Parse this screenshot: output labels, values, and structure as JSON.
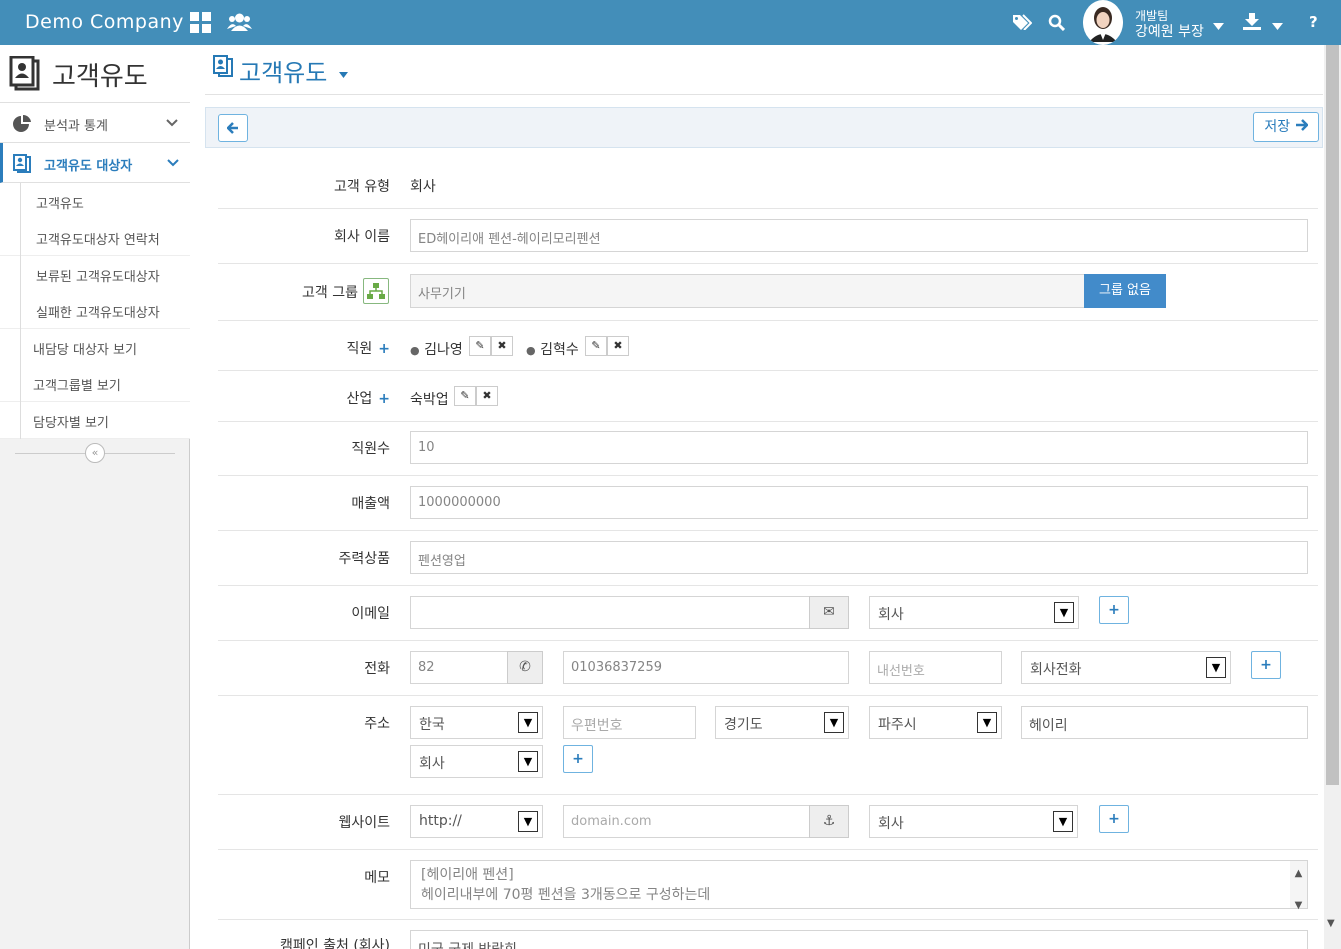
{
  "topbar": {
    "brand": "Demo Company",
    "user_team": "개발팀",
    "user_name": "강예원 부장"
  },
  "sidebar": {
    "title": "고객유도",
    "items": [
      {
        "label": "분석과 통계"
      },
      {
        "label": "고객유도 대상자"
      }
    ],
    "subitems": [
      {
        "label": "고객유도"
      },
      {
        "label": "고객유도대상자 연락처"
      },
      {
        "label": "보류된 고객유도대상자"
      },
      {
        "label": "실패한 고객유도대상자"
      },
      {
        "label": "내담당 대상자 보기"
      },
      {
        "label": "고객그룹별 보기"
      },
      {
        "label": "담당자별 보기"
      }
    ]
  },
  "page": {
    "title": "고객유도",
    "save_label": "저장"
  },
  "form": {
    "customer_type": {
      "label": "고객 유형",
      "value": "회사"
    },
    "company_name": {
      "label": "회사 이름",
      "value": "ED헤이리애 펜션-헤이리모리펜션"
    },
    "customer_group": {
      "label": "고객 그룹",
      "value": "사무기기",
      "button": "그룹 없음"
    },
    "staff": {
      "label": "직원",
      "members": [
        "김나영",
        "김혁수"
      ]
    },
    "industry": {
      "label": "산업",
      "value": "숙박업"
    },
    "employees": {
      "label": "직원수",
      "value": "10"
    },
    "revenue": {
      "label": "매출액",
      "value": "1000000000"
    },
    "main_product": {
      "label": "주력상품",
      "value": "펜션영업"
    },
    "email": {
      "label": "이메일",
      "value": "",
      "type": "회사"
    },
    "phone": {
      "label": "전화",
      "country_code": "82",
      "number": "01036837259",
      "ext_placeholder": "내선번호",
      "type": "회사전화"
    },
    "address": {
      "label": "주소",
      "country": "한국",
      "zip_placeholder": "우편번호",
      "province": "경기도",
      "city": "파주시",
      "street": "헤이리",
      "type": "회사"
    },
    "website": {
      "label": "웹사이트",
      "protocol": "http://",
      "domain_placeholder": "domain.com",
      "type": "회사"
    },
    "memo": {
      "label": "메모",
      "line1": "[헤이리애 펜션]",
      "line2": "헤이리내부에 70평 펜션을 3개동으로 구성하는데"
    },
    "campaign": {
      "label": "캠페인 출처 (회사)",
      "value": "미국 국제 박람회"
    }
  }
}
